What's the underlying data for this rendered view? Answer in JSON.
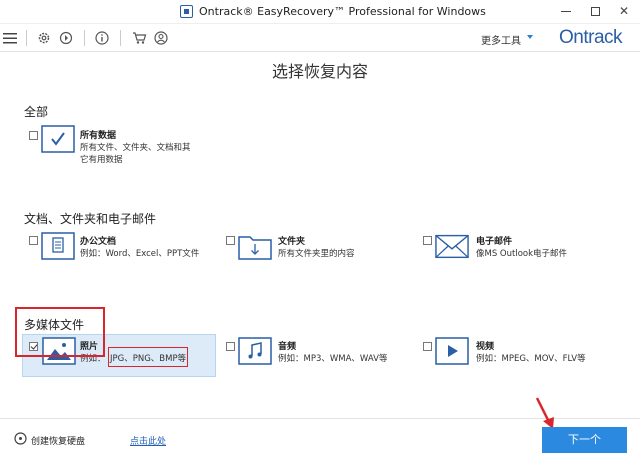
{
  "window": {
    "title": "Ontrack® EasyRecovery™ Professional for Windows",
    "min_glyph": "—",
    "close_glyph": "✕"
  },
  "toolbar": {
    "more_tools": "更多工具",
    "brand": "Ontrack",
    "icons": [
      "menu-icon",
      "gear-icon",
      "restore-icon",
      "info-icon",
      "cart-icon",
      "user-icon"
    ]
  },
  "main": {
    "title": "选择恢复内容",
    "sections": [
      {
        "title": "全部",
        "options": [
          {
            "title": "所有数据",
            "desc_lines": [
              "所有文件、文件夹、文档和其",
              "它有用数据"
            ],
            "checked": false,
            "icon": "checkmark-box-icon"
          }
        ]
      },
      {
        "title": "文档、文件夹和电子邮件",
        "options": [
          {
            "title": "办公文档",
            "desc_lines": [
              "例如：Word、Excel、PPT文件"
            ],
            "checked": false,
            "icon": "document-icon"
          },
          {
            "title": "文件夹",
            "desc_lines": [
              "所有文件夹里的内容"
            ],
            "checked": false,
            "icon": "folder-icon"
          },
          {
            "title": "电子邮件",
            "desc_lines": [
              "像MS Outlook电子邮件"
            ],
            "checked": false,
            "icon": "email-icon"
          }
        ]
      },
      {
        "title": "多媒体文件",
        "options": [
          {
            "title": "照片",
            "desc_prefix": "例如：",
            "desc_suffix": "JPG、PNG、BMP等",
            "checked": true,
            "icon": "photo-icon"
          },
          {
            "title": "音频",
            "desc_lines": [
              "例如：MP3、WMA、WAV等"
            ],
            "checked": false,
            "icon": "music-icon"
          },
          {
            "title": "视频",
            "desc_lines": [
              "例如：MPEG、MOV、FLV等"
            ],
            "checked": false,
            "icon": "video-icon"
          }
        ]
      }
    ]
  },
  "footer": {
    "create_disk": "创建恢复硬盘",
    "click_here": "点击此处",
    "next": "下一个"
  },
  "colors": {
    "accent": "#2b8ae0",
    "brand": "#2a5fa6",
    "highlight": "#ddeaf7",
    "annotation_red": "#d9262c"
  }
}
